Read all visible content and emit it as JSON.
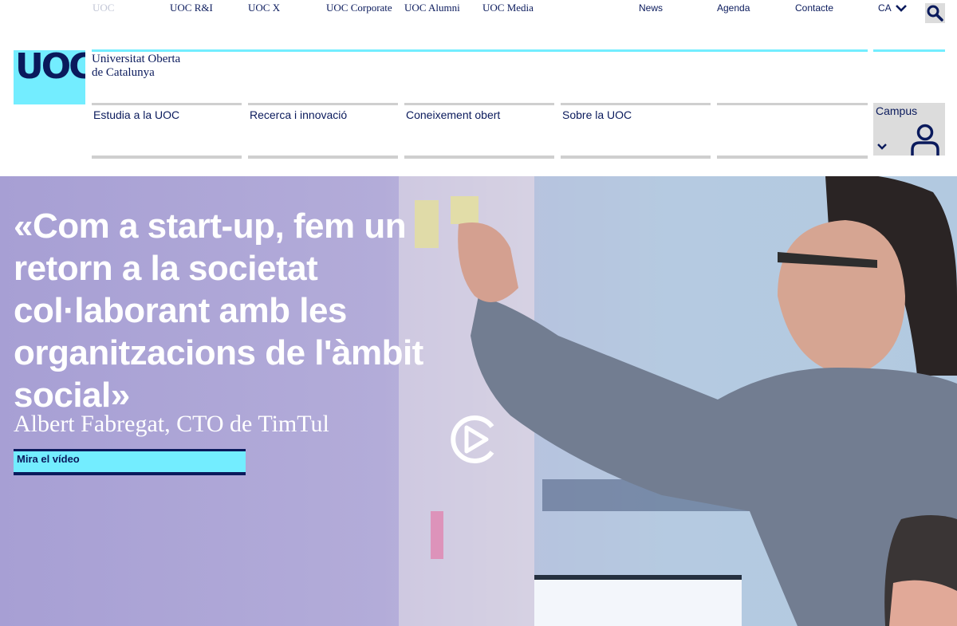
{
  "topbar": {
    "links": [
      "UOC",
      "UOC R&I",
      "UOC X",
      "UOC Corporate",
      "UOC Alumni",
      "UOC Media"
    ],
    "utility": [
      "News",
      "Agenda",
      "Contacte"
    ],
    "language": "CA"
  },
  "logo": {
    "mark": "UOC",
    "line1": "Universitat Oberta",
    "line2": "de Catalunya"
  },
  "nav": {
    "items": [
      "Estudia a la UOC",
      "Recerca i innovació",
      "Coneixement obert",
      "Sobre la UOC"
    ],
    "campus": "Campus"
  },
  "hero": {
    "quote": "«Com a start-up, fem un retorn a la societat col·laborant amb les organitzacions de l'àmbit social»",
    "author": "Albert Fabregat, CTO de TimTul",
    "cta": "Mira el vídeo"
  },
  "colors": {
    "accent": "#73edff",
    "navy": "#0a1a5c"
  }
}
